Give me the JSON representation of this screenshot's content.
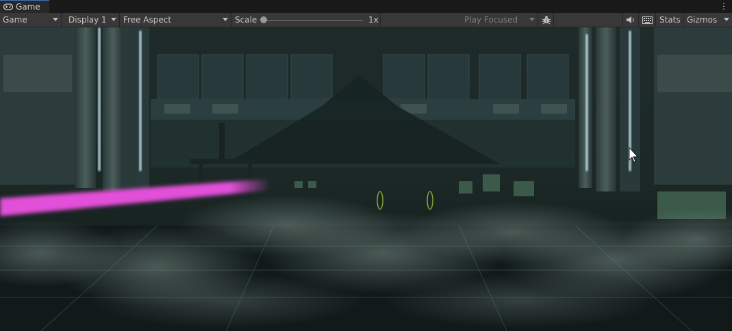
{
  "window": {
    "tab_label": "Game",
    "tab_icon": "gamepad-icon",
    "menu_icon": "kebab-menu-icon"
  },
  "toolbar": {
    "view_select": "Game",
    "display_select": "Display 1",
    "aspect_select": "Free Aspect",
    "scale_label": "Scale",
    "scale_value": "1x",
    "scale_level": 0.0,
    "play_mode_select": "Play Focused",
    "bug_icon": "bug-icon",
    "audio_icon": "speaker-icon",
    "keyboard_icon": "keyboard-icon",
    "stats_label": "Stats",
    "gizmos_label": "Gizmos"
  },
  "colors": {
    "accent": "#3a79bb",
    "toolbar_bg": "#383838",
    "laser": "#e24fd8",
    "scene_tint": "#1f3330"
  }
}
